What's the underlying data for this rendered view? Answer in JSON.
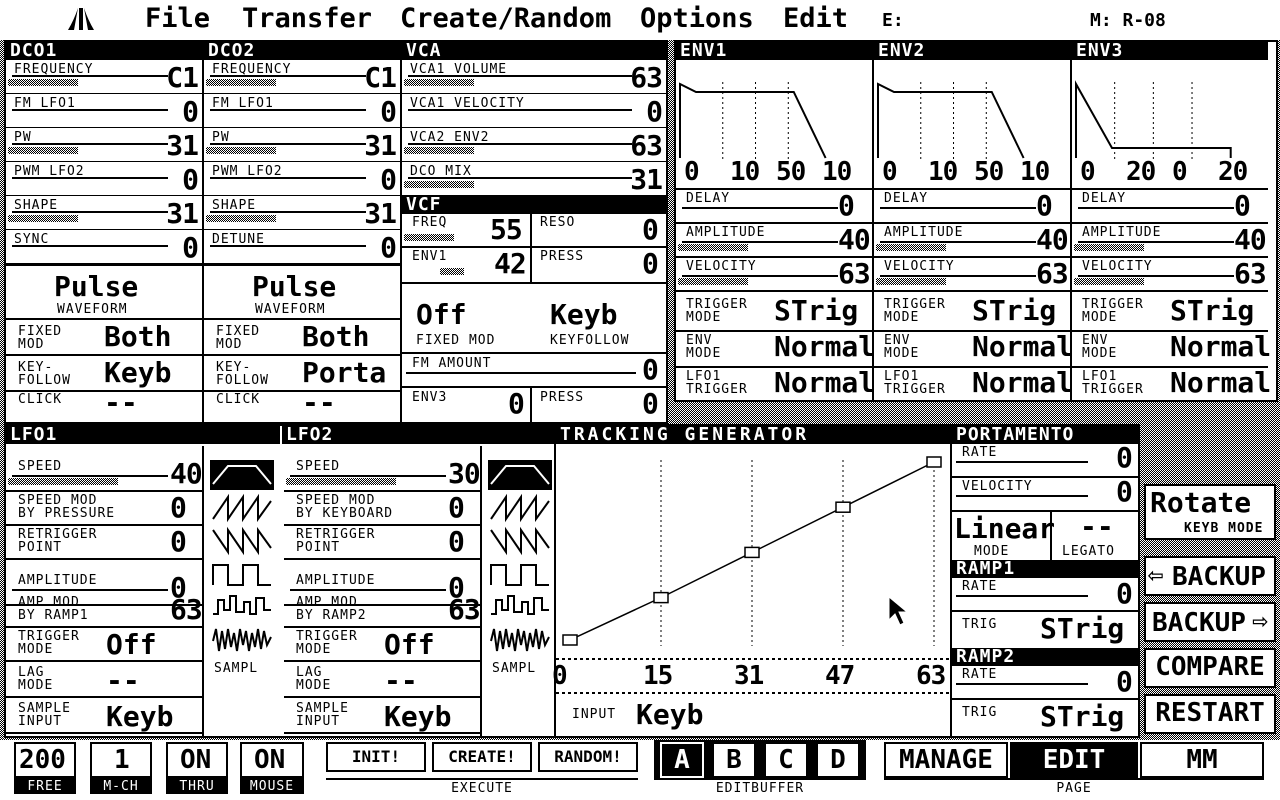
{
  "menu": {
    "logo_icon": "atari-fuji-icon",
    "items": [
      "File",
      "Transfer",
      "Create/Random",
      "Options",
      "Edit"
    ],
    "edit_indicator": "E:",
    "memory_indicator": "M: R-08"
  },
  "dco1": {
    "title": "DCO1",
    "rows": [
      {
        "label": "FREQUENCY",
        "value": "C1"
      },
      {
        "label": "FM LFO1",
        "value": "0"
      },
      {
        "label": "PW",
        "value": "31"
      },
      {
        "label": "PWM LFO2",
        "value": "0"
      },
      {
        "label": "SHAPE",
        "value": "31"
      },
      {
        "label": "SYNC",
        "value": "0"
      }
    ],
    "waveform": {
      "value": "Pulse",
      "caption": "WAVEFORM"
    },
    "fixed_mod": {
      "label1": "FIXED",
      "label2": "MOD",
      "value": "Both"
    },
    "keyfollow": {
      "label1": "KEY-",
      "label2": "FOLLOW",
      "value": "Keyb"
    },
    "click": {
      "label": "CLICK",
      "value": "--"
    }
  },
  "dco2": {
    "title": "DCO2",
    "rows": [
      {
        "label": "FREQUENCY",
        "value": "C1"
      },
      {
        "label": "FM LFO1",
        "value": "0"
      },
      {
        "label": "PW",
        "value": "31"
      },
      {
        "label": "PWM LFO2",
        "value": "0"
      },
      {
        "label": "SHAPE",
        "value": "31"
      },
      {
        "label": "DETUNE",
        "value": "0"
      }
    ],
    "waveform": {
      "value": "Pulse",
      "caption": "WAVEFORM"
    },
    "fixed_mod": {
      "label1": "FIXED",
      "label2": "MOD",
      "value": "Both"
    },
    "keyfollow": {
      "label1": "KEY-",
      "label2": "FOLLOW",
      "value": "Porta"
    },
    "click": {
      "label": "CLICK",
      "value": "--"
    }
  },
  "vca": {
    "title": "VCA",
    "rows": [
      {
        "label": "VCA1 VOLUME",
        "value": "63"
      },
      {
        "label": "VCA1 VELOCITY",
        "value": "0"
      },
      {
        "label": "VCA2 ENV2",
        "value": "63"
      },
      {
        "label": "DCO MIX",
        "value": "31"
      }
    ]
  },
  "vcf": {
    "title": "VCF",
    "freq": {
      "label": "FREQ",
      "value": "55"
    },
    "reso": {
      "label": "RESO",
      "value": "0"
    },
    "env1": {
      "label": "ENV1",
      "value": "42"
    },
    "press": {
      "label": "PRESS",
      "value": "0"
    },
    "fixed_mod": {
      "value": "Off",
      "caption": "FIXED MOD"
    },
    "keyfollow": {
      "value": "Keyb",
      "caption": "KEYFOLLOW"
    },
    "fm_amount": {
      "label": "FM AMOUNT",
      "value": "0"
    },
    "env3": {
      "label": "ENV3",
      "value": "0"
    },
    "press2": {
      "label": "PRESS",
      "value": "0"
    }
  },
  "envs": [
    {
      "title": "ENV1",
      "times": [
        "0",
        "10",
        "50",
        "10"
      ],
      "delay": "0",
      "amplitude": "40",
      "velocity": "63",
      "trigger_mode": "STrig",
      "env_mode": "Normal",
      "lfo1_trigger": "Normal"
    },
    {
      "title": "ENV2",
      "times": [
        "0",
        "10",
        "50",
        "10"
      ],
      "delay": "0",
      "amplitude": "40",
      "velocity": "63",
      "trigger_mode": "STrig",
      "env_mode": "Normal",
      "lfo1_trigger": "Normal"
    },
    {
      "title": "ENV3",
      "times": [
        "0",
        "20",
        "0",
        "20"
      ],
      "delay": "0",
      "amplitude": "40",
      "velocity": "63",
      "trigger_mode": "STrig",
      "env_mode": "Normal",
      "lfo1_trigger": "Normal"
    }
  ],
  "env_labels": {
    "delay": "DELAY",
    "amplitude": "AMPLITUDE",
    "velocity": "VELOCITY",
    "trigger1": "TRIGGER",
    "trigger2": "MODE",
    "envmode1": "ENV",
    "envmode2": "MODE",
    "lfo1trig1": "LFO1",
    "lfo1trig2": "TRIGGER"
  },
  "lfo1": {
    "title": "LFO1",
    "speed": {
      "label": "SPEED",
      "value": "40"
    },
    "speed_mod": {
      "label1": "SPEED MOD",
      "label2": "BY PRESSURE",
      "value": "0"
    },
    "retrigger": {
      "label1": "RETRIGGER",
      "label2": "POINT",
      "value": "0"
    },
    "amplitude": {
      "label": "AMPLITUDE",
      "value": "0"
    },
    "amp_mod": {
      "label1": "AMP MOD",
      "label2": "BY RAMP1",
      "value": "63"
    },
    "trigger_mode": {
      "label1": "TRIGGER",
      "label2": "MODE",
      "value": "Off"
    },
    "lag_mode": {
      "label1": "LAG",
      "label2": "MODE",
      "value": "--"
    },
    "sample_input": {
      "label1": "SAMPLE",
      "label2": "INPUT",
      "value": "Keyb"
    },
    "sampl_label": "SAMPL"
  },
  "lfo2": {
    "title": "LFO2",
    "speed": {
      "label": "SPEED",
      "value": "30"
    },
    "speed_mod": {
      "label1": "SPEED MOD",
      "label2": "BY KEYBOARD",
      "value": "0"
    },
    "retrigger": {
      "label1": "RETRIGGER",
      "label2": "POINT",
      "value": "0"
    },
    "amplitude": {
      "label": "AMPLITUDE",
      "value": "0"
    },
    "amp_mod": {
      "label1": "AMP MOD",
      "label2": "BY RAMP2",
      "value": "63"
    },
    "trigger_mode": {
      "label1": "TRIGGER",
      "label2": "MODE",
      "value": "Off"
    },
    "lag_mode": {
      "label1": "LAG",
      "label2": "MODE",
      "value": "--"
    },
    "sample_input": {
      "label1": "SAMPLE",
      "label2": "INPUT",
      "value": "Keyb"
    },
    "sampl_label": "SAMPL"
  },
  "tracking": {
    "title": "TRACKING GENERATOR",
    "points": [
      "0",
      "15",
      "31",
      "47",
      "63"
    ],
    "input_label": "INPUT",
    "input_value": "Keyb"
  },
  "portamento": {
    "title": "PORTAMENTO",
    "rate": {
      "label": "RATE",
      "value": "0"
    },
    "velocity": {
      "label": "VELOCITY",
      "value": "0"
    },
    "mode": {
      "value": "Linear",
      "caption": "MODE"
    },
    "legato": {
      "value": "--",
      "caption": "LEGATO"
    }
  },
  "ramp1": {
    "title": "RAMP1",
    "rate_label": "RATE",
    "rate": "0",
    "trig_label": "TRIG",
    "trig": "STrig"
  },
  "ramp2": {
    "title": "RAMP2",
    "rate_label": "RATE",
    "rate": "0",
    "trig_label": "TRIG",
    "trig": "STrig"
  },
  "side_buttons": {
    "rotate": {
      "value": "Rotate",
      "caption": "KEYB MODE"
    },
    "backup_left": "BACKUP",
    "backup_right": "BACKUP",
    "compare": "COMPARE",
    "restart": "RESTART"
  },
  "bottom": {
    "free": {
      "value": "200",
      "caption": "FREE"
    },
    "mch": {
      "value": "1",
      "caption": "M-CH"
    },
    "thru": {
      "value": "ON",
      "caption": "THRU"
    },
    "mouse": {
      "value": "ON",
      "caption": "MOUSE"
    },
    "init": "INIT!",
    "create": "CREATE!",
    "random": "RANDOM!",
    "execute_caption": "EXECUTE",
    "editbuffer": [
      "A",
      "B",
      "C",
      "D"
    ],
    "editbuffer_caption": "EDITBUFFER",
    "pages": [
      "MANAGE",
      "EDIT",
      "MM"
    ],
    "page_caption": "PAGE"
  }
}
